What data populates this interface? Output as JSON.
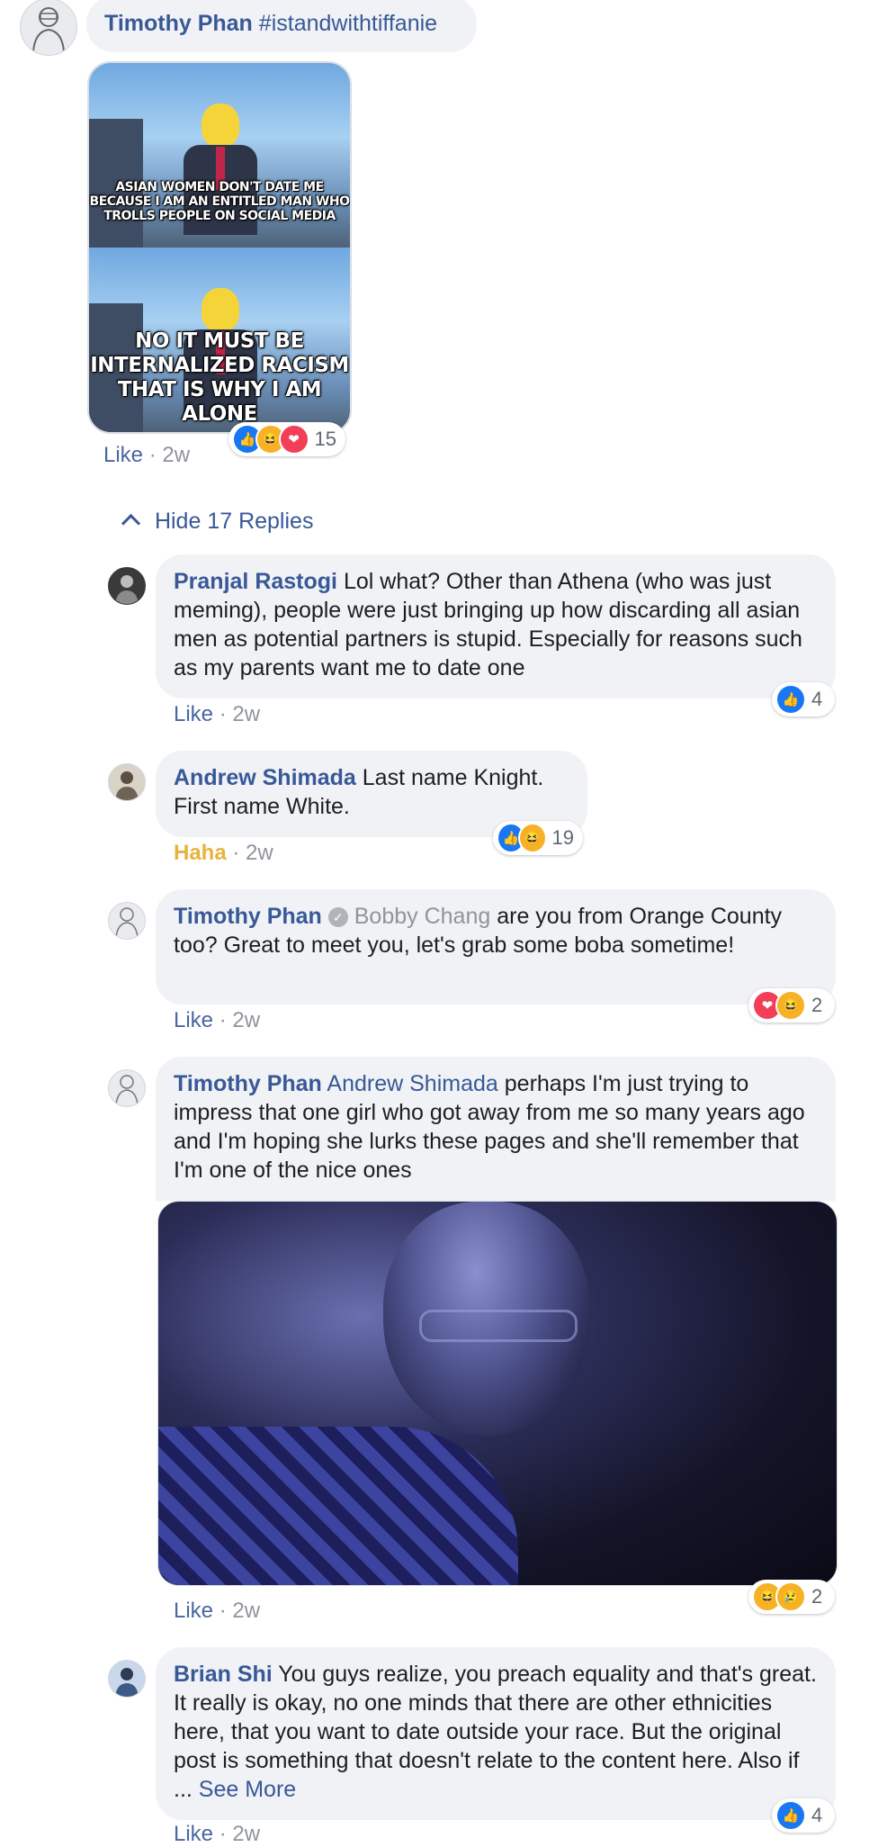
{
  "top_comment": {
    "author": "Timothy Phan",
    "tag": "#istandwithtiffanie",
    "meme": {
      "top_text": "ASIAN WOMEN DON'T DATE ME BECAUSE I AM AN ENTITLED MAN WHO TROLLS PEOPLE ON SOCIAL MEDIA",
      "bottom_text": "NO IT MUST BE INTERNALIZED RACISM THAT IS WHY I AM ALONE"
    },
    "like": "Like",
    "time": "2w",
    "reactions_count": "15"
  },
  "hide_replies": "Hide 17 Replies",
  "replies": [
    {
      "author": "Pranjal Rastogi",
      "text": "Lol what? Other than Athena (who was just meming), people were just bringing up how discarding all asian men as potential partners is stupid. Especially for reasons such as my parents want me to date one",
      "like": "Like",
      "time": "2w",
      "reactions_count": "4"
    },
    {
      "author": "Andrew Shimada",
      "text_line1": "Last name Knight.",
      "text_line2": "First name White.",
      "like": "Haha",
      "time": "2w",
      "reactions_count": "19"
    },
    {
      "author": "Timothy Phan",
      "mention": "Bobby Chang",
      "text": "are you from Orange County too? Great to meet you, let's grab some boba sometime!",
      "like": "Like",
      "time": "2w",
      "reactions_count": "2"
    },
    {
      "author": "Timothy Phan",
      "mention": "Andrew Shimada",
      "text": "perhaps I'm just trying to impress that one girl who got away from me so many years ago and I'm hoping she lurks these pages and she'll remember that I'm one of the nice ones",
      "like": "Like",
      "time": "2w",
      "reactions_count": "2"
    },
    {
      "author": "Brian Shi",
      "text": "You guys realize, you preach equality and that's great. It really is okay, no one minds that there are other ethnicities here, that you want to date outside your race. But the original post is something that doesn't relate to the content here. Also if ...",
      "see_more": "See More",
      "like": "Like",
      "time": "2w",
      "reactions_count": "4"
    }
  ],
  "separator": "·"
}
